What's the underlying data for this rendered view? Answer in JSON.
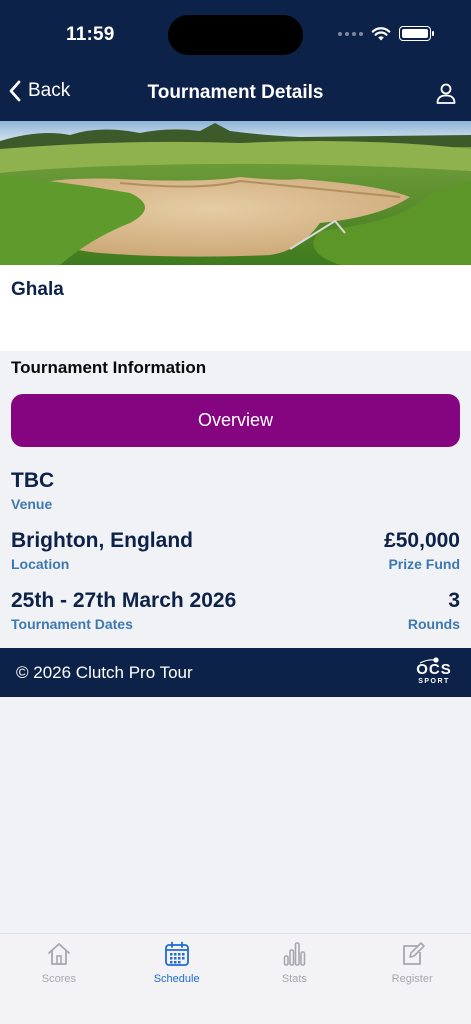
{
  "status_bar": {
    "time": "11:59"
  },
  "nav": {
    "back_label": "Back",
    "title": "Tournament Details"
  },
  "tournament": {
    "name": "Ghala"
  },
  "info": {
    "section_title": "Tournament Information",
    "overview_button": "Overview",
    "venue_value": "TBC",
    "venue_label": "Venue",
    "location_value": "Brighton, England",
    "location_label": "Location",
    "prize_value": "£50,000",
    "prize_label": "Prize Fund",
    "dates_value": "25th - 27th March 2026",
    "dates_label": "Tournament Dates",
    "rounds_value": "3",
    "rounds_label": "Rounds"
  },
  "footer": {
    "copyright": "© 2026 Clutch Pro Tour",
    "logo_main": "OCS",
    "logo_sub": "SPORT"
  },
  "tabs": [
    {
      "label": "Scores",
      "icon": "home-icon",
      "active": false
    },
    {
      "label": "Schedule",
      "icon": "calendar-icon",
      "active": true
    },
    {
      "label": "Stats",
      "icon": "bar-chart-icon",
      "active": false
    },
    {
      "label": "Register",
      "icon": "edit-icon",
      "active": false
    }
  ],
  "colors": {
    "header_bg": "#0d2249",
    "accent_purple": "#850580",
    "label_blue": "#3d79b0",
    "tab_active": "#1f6bd1"
  }
}
